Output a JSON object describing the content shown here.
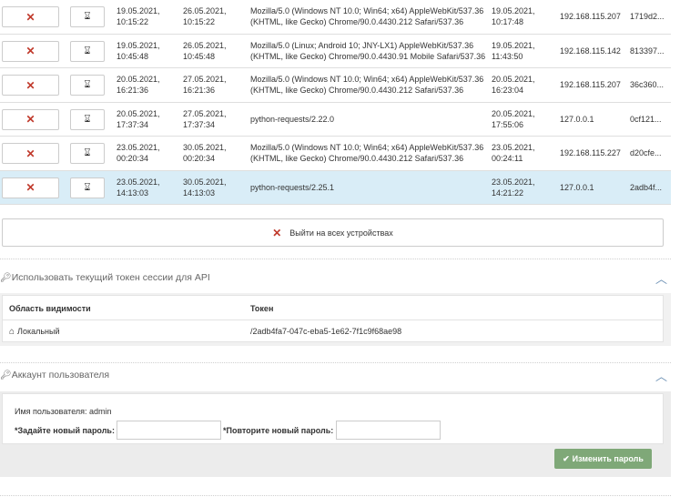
{
  "sessions": [
    {
      "created": [
        "19.05.2021,",
        "10:15:22"
      ],
      "expires": [
        "26.05.2021,",
        "10:15:22"
      ],
      "agent": [
        "Mozilla/5.0 (Windows NT 10.0; Win64; x64) AppleWebKit/537.36",
        "(KHTML, like Gecko) Chrome/90.0.4430.212 Safari/537.36"
      ],
      "last": [
        "19.05.2021,",
        "10:17:48"
      ],
      "ip": "192.168.115.207",
      "id": "1719d2...",
      "active": false
    },
    {
      "created": [
        "19.05.2021,",
        "10:45:48"
      ],
      "expires": [
        "26.05.2021,",
        "10:45:48"
      ],
      "agent": [
        "Mozilla/5.0 (Linux; Android 10; JNY-LX1) AppleWebKit/537.36",
        "(KHTML, like Gecko) Chrome/90.0.4430.91 Mobile Safari/537.36"
      ],
      "last": [
        "19.05.2021,",
        "11:43:50"
      ],
      "ip": "192.168.115.142",
      "id": "813397...",
      "active": false
    },
    {
      "created": [
        "20.05.2021,",
        "16:21:36"
      ],
      "expires": [
        "27.05.2021,",
        "16:21:36"
      ],
      "agent": [
        "Mozilla/5.0 (Windows NT 10.0; Win64; x64) AppleWebKit/537.36",
        "(KHTML, like Gecko) Chrome/90.0.4430.212 Safari/537.36"
      ],
      "last": [
        "20.05.2021,",
        "16:23:04"
      ],
      "ip": "192.168.115.207",
      "id": "36c360...",
      "active": false
    },
    {
      "created": [
        "20.05.2021,",
        "17:37:34"
      ],
      "expires": [
        "27.05.2021,",
        "17:37:34"
      ],
      "agent": [
        "python-requests/2.22.0",
        ""
      ],
      "last": [
        "20.05.2021,",
        "17:55:06"
      ],
      "ip": "127.0.0.1",
      "id": "0cf121...",
      "active": false
    },
    {
      "created": [
        "23.05.2021,",
        "00:20:34"
      ],
      "expires": [
        "30.05.2021,",
        "00:20:34"
      ],
      "agent": [
        "Mozilla/5.0 (Windows NT 10.0; Win64; x64) AppleWebKit/537.36",
        "(KHTML, like Gecko) Chrome/90.0.4430.212 Safari/537.36"
      ],
      "last": [
        "23.05.2021,",
        "00:24:11"
      ],
      "ip": "192.168.115.227",
      "id": "d20cfe...",
      "active": false
    },
    {
      "created": [
        "23.05.2021,",
        "14:13:03"
      ],
      "expires": [
        "30.05.2021,",
        "14:13:03"
      ],
      "agent": [
        "python-requests/2.25.1",
        ""
      ],
      "last": [
        "23.05.2021,",
        "14:21:22"
      ],
      "ip": "127.0.0.1",
      "id": "2adb4f...",
      "active": true
    }
  ],
  "icons": {
    "remove": "times-icon",
    "extend": "hourglass-icon",
    "key": "key-icon",
    "home": "home-icon",
    "check": "check-icon",
    "chevron": "chevron-up-icon"
  },
  "colors": {
    "danger": "#c0392b",
    "active_row": "#d9edf7",
    "success_button": "#7fa878",
    "chevron": "#6a8fb3"
  },
  "logout_all_label": "Выйти на всех устройствах",
  "api_token": {
    "title": "Использовать текущий токен сессии для API",
    "headers": {
      "scope": "Область видимости",
      "token": "Токен"
    },
    "row": {
      "scope": "Локальный",
      "token": "/2adb4fa7-047c-eba5-1e62-7f1c9f68ae98"
    }
  },
  "account": {
    "title": "Аккаунт пользователя",
    "username_label": "Имя пользователя:",
    "username": "admin",
    "new_password_label": "*Задайте новый пароль:",
    "repeat_password_label": "*Повторите новый пароль:",
    "change_password_label": "Изменить пароль"
  }
}
